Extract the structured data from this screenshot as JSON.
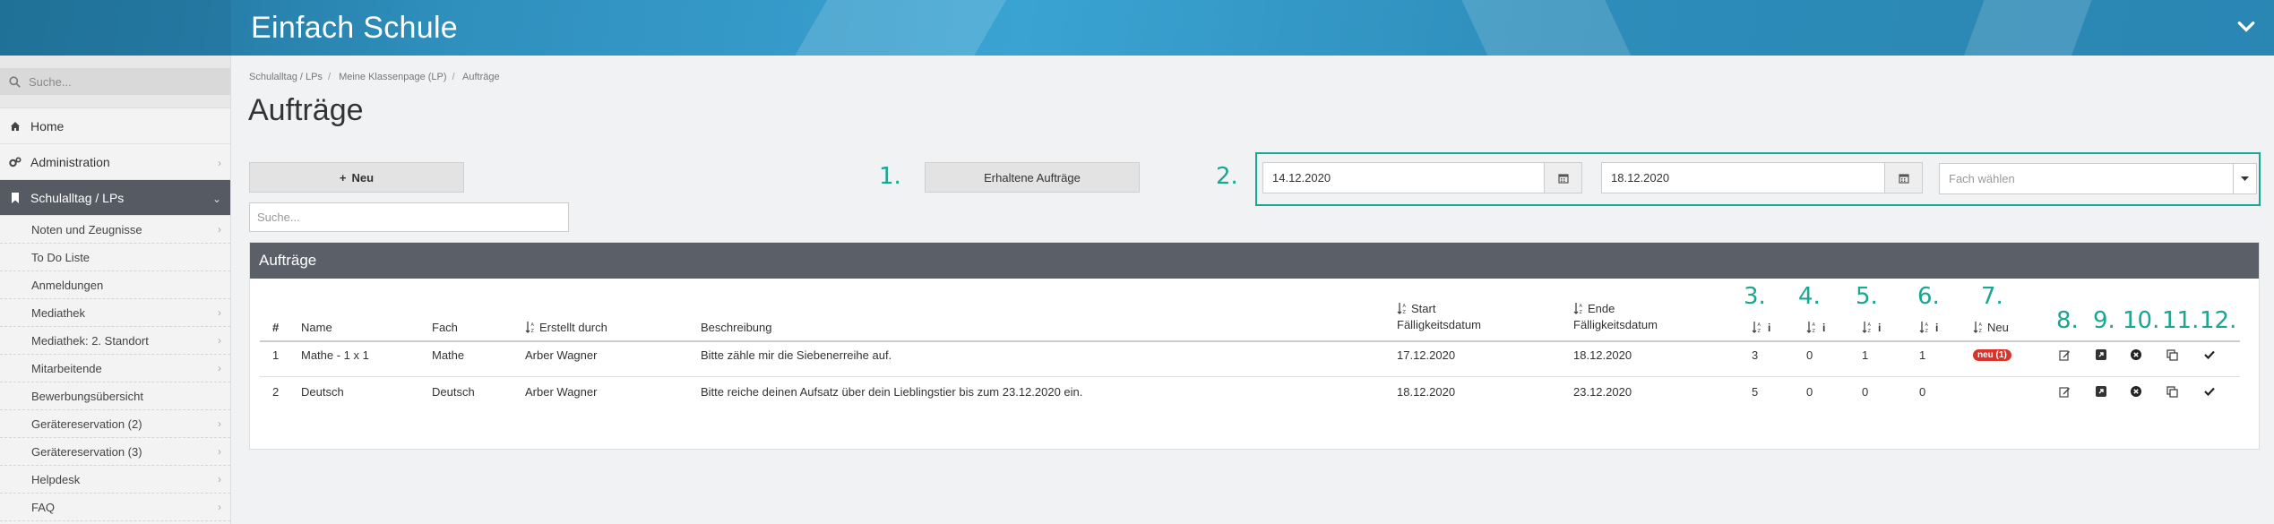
{
  "app": {
    "title": "Einfach Schule"
  },
  "sidebar": {
    "search_placeholder": "Suche...",
    "items": [
      {
        "label": "Home",
        "icon": "home-icon"
      },
      {
        "label": "Administration",
        "icon": "gears-icon"
      },
      {
        "label": "Schulalltag / LPs",
        "icon": "bookmark-icon",
        "active": true
      }
    ],
    "subitems": [
      "Noten und Zeugnisse",
      "To Do Liste",
      "Anmeldungen",
      "Mediathek",
      "Mediathek: 2. Standort",
      "Mitarbeitende",
      "Bewerbungsübersicht",
      "Gerätereservation (2)",
      "Gerätereservation (3)",
      "Helpdesk",
      "FAQ"
    ]
  },
  "breadcrumb": [
    "Schulalltag / LPs",
    "Meine Klassenpage (LP)",
    "Aufträge"
  ],
  "page_title": "Aufträge",
  "toolbar": {
    "new_label": "Neu",
    "received_label": "Erhaltene Aufträge",
    "search_placeholder": "Suche...",
    "date_from": "14.12.2020",
    "date_to": "18.12.2020",
    "subject_placeholder": "Fach wählen"
  },
  "markers": [
    "1.",
    "2.",
    "3.",
    "4.",
    "5.",
    "6.",
    "7.",
    "8.",
    "9.",
    "10.",
    "11.",
    "12."
  ],
  "panel": {
    "title": "Aufträge"
  },
  "table": {
    "headers": {
      "num": "#",
      "name": "Name",
      "subject": "Fach",
      "created_by": "Erstellt durch",
      "description": "Beschreibung",
      "start_l1": "Start",
      "start_l2": "Fälligkeitsdatum",
      "end_l1": "Ende",
      "end_l2": "Fälligkeitsdatum",
      "new": "Neu"
    },
    "rows": [
      {
        "num": "1",
        "name": "Mathe - 1 x 1",
        "subject": "Mathe",
        "created_by": "Arber Wagner",
        "description": "Bitte zähle mir die Siebenerreihe auf.",
        "start": "17.12.2020",
        "end": "18.12.2020",
        "c3": "3",
        "c4": "0",
        "c5": "1",
        "c6": "1",
        "badge": "neu (1)"
      },
      {
        "num": "2",
        "name": "Deutsch",
        "subject": "Deutsch",
        "created_by": "Arber Wagner",
        "description": "Bitte reiche deinen Aufsatz über dein Lieblingstier bis zum 23.12.2020 ein.",
        "start": "18.12.2020",
        "end": "23.12.2020",
        "c3": "5",
        "c4": "0",
        "c5": "0",
        "c6": "0",
        "badge": ""
      }
    ]
  },
  "colors": {
    "accent": "#1aa690",
    "header": "#2f8fbd",
    "panel_head": "#5a5f68",
    "badge": "#d9342b"
  }
}
